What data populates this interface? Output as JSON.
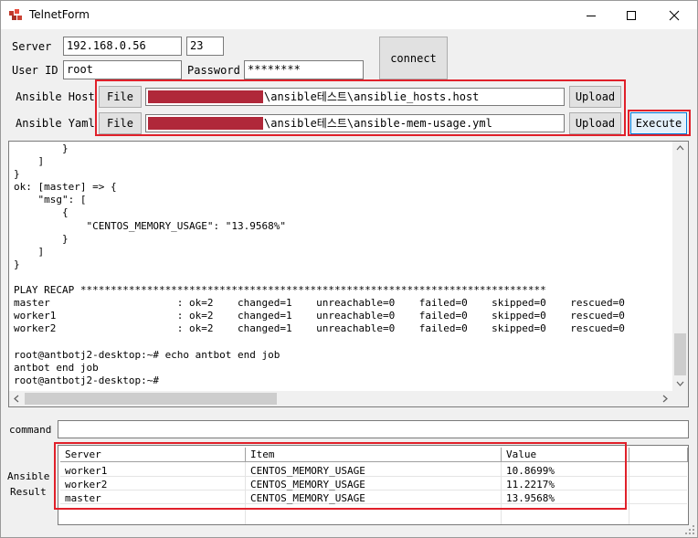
{
  "window": {
    "title": "TelnetForm"
  },
  "connection": {
    "server_label": "Server",
    "server_value": "192.168.0.56",
    "port_value": "23",
    "userid_label": "User ID",
    "userid_value": "root",
    "password_label": "Password",
    "password_value": "********",
    "connect_label": "connect"
  },
  "ansible": {
    "host_label": "Ansible Host",
    "yaml_label": "Ansible Yaml",
    "file_label": "File",
    "upload_label": "Upload",
    "execute_label": "Execute",
    "host_path": "\\ansible테스트\\ansiblie_hosts.host",
    "yaml_path": "\\ansible테스트\\ansible-mem-usage.yml"
  },
  "console": {
    "lines": [
      "        }",
      "    ]",
      "}",
      "ok: [master] => {",
      "    \"msg\": [",
      "        {",
      "            \"CENTOS_MEMORY_USAGE\": \"13.9568%\"",
      "        }",
      "    ]",
      "}",
      "",
      "PLAY RECAP *****************************************************************************",
      "master                     : ok=2    changed=1    unreachable=0    failed=0    skipped=0    rescued=0",
      "worker1                    : ok=2    changed=1    unreachable=0    failed=0    skipped=0    rescued=0",
      "worker2                    : ok=2    changed=1    unreachable=0    failed=0    skipped=0    rescued=0",
      "",
      "root@antbotj2-desktop:~# echo antbot end job",
      "antbot end job",
      "root@antbotj2-desktop:~#"
    ]
  },
  "command": {
    "label": "command",
    "value": ""
  },
  "result": {
    "label_line1": "Ansible",
    "label_line2": "Result",
    "columns": [
      "Server",
      "Item",
      "Value"
    ],
    "rows": [
      [
        "worker1",
        "CENTOS_MEMORY_USAGE",
        "10.8699%"
      ],
      [
        "worker2",
        "CENTOS_MEMORY_USAGE",
        "11.2217%"
      ],
      [
        "master",
        "CENTOS_MEMORY_USAGE",
        "13.9568%"
      ]
    ]
  },
  "colors": {
    "highlight": "#e0202a",
    "redaction": "#b0283a",
    "window_bg": "#f0f0f0"
  },
  "icons": [
    "app-icon",
    "minimize-icon",
    "maximize-icon",
    "close-icon",
    "scroll-up-icon",
    "scroll-down-icon",
    "scroll-left-icon",
    "scroll-right-icon",
    "resize-grip-icon"
  ]
}
